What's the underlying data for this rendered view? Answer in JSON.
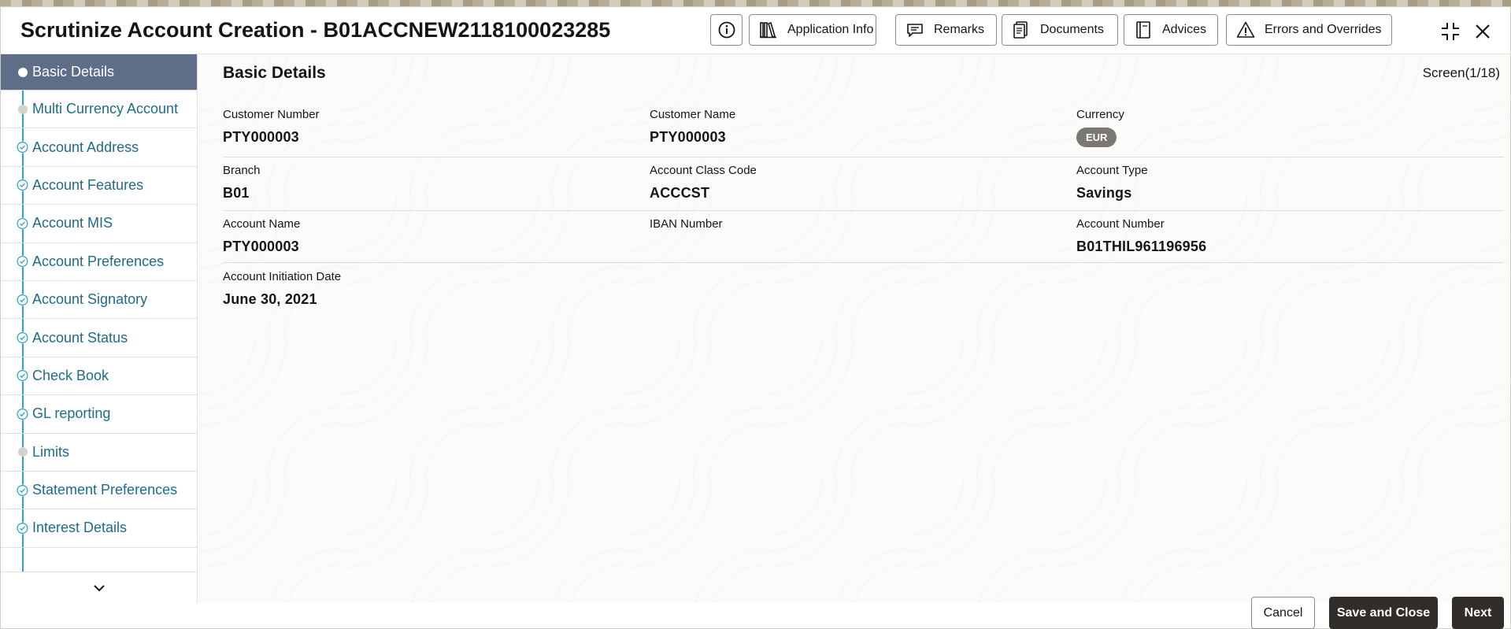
{
  "header": {
    "title": "Scrutinize Account Creation - B01ACCNEW2118100023285",
    "buttons": {
      "application_info": "Application Info",
      "remarks": "Remarks",
      "documents": "Documents",
      "advices": "Advices",
      "errors_overrides": "Errors and Overrides"
    },
    "icons": [
      "info-icon",
      "library-icon",
      "chat-icon",
      "documents-icon",
      "advices-icon",
      "warning-icon",
      "collapse-icon",
      "close-icon"
    ]
  },
  "sidebar": {
    "items": [
      {
        "label": "Basic Details",
        "state": "active"
      },
      {
        "label": "Multi Currency Account",
        "state": "pending"
      },
      {
        "label": "Account Address",
        "state": "done"
      },
      {
        "label": "Account Features",
        "state": "done"
      },
      {
        "label": "Account MIS",
        "state": "done"
      },
      {
        "label": "Account Preferences",
        "state": "done"
      },
      {
        "label": "Account Signatory",
        "state": "done"
      },
      {
        "label": "Account Status",
        "state": "done"
      },
      {
        "label": "Check Book",
        "state": "done"
      },
      {
        "label": "GL reporting",
        "state": "done"
      },
      {
        "label": "Limits",
        "state": "pending"
      },
      {
        "label": "Statement Preferences",
        "state": "done"
      },
      {
        "label": "Interest Details",
        "state": "done"
      }
    ]
  },
  "main": {
    "section_title": "Basic Details",
    "screen_count": "Screen(1/18)",
    "fields": {
      "customer_number": {
        "label": "Customer Number",
        "value": "PTY000003"
      },
      "customer_name": {
        "label": "Customer Name",
        "value": "PTY000003"
      },
      "currency": {
        "label": "Currency",
        "value": "EUR"
      },
      "branch": {
        "label": "Branch",
        "value": "B01"
      },
      "account_class_code": {
        "label": "Account Class Code",
        "value": "ACCCST"
      },
      "account_type": {
        "label": "Account Type",
        "value": "Savings"
      },
      "account_name": {
        "label": "Account Name",
        "value": "PTY000003"
      },
      "iban_number": {
        "label": "IBAN Number",
        "value": ""
      },
      "account_number": {
        "label": "Account Number",
        "value": "B01THIL961196956"
      },
      "account_initiation_date": {
        "label": "Account Initiation Date",
        "value": "June 30, 2021"
      }
    }
  },
  "footer": {
    "cancel": "Cancel",
    "save_close": "Save and Close",
    "next": "Next"
  },
  "colors": {
    "active_nav": "#5e6d88",
    "nav_text": "#1e6b8a",
    "timeline": "#2aa3c7",
    "primary_button": "#312d2a",
    "badge": "#7b7771"
  }
}
